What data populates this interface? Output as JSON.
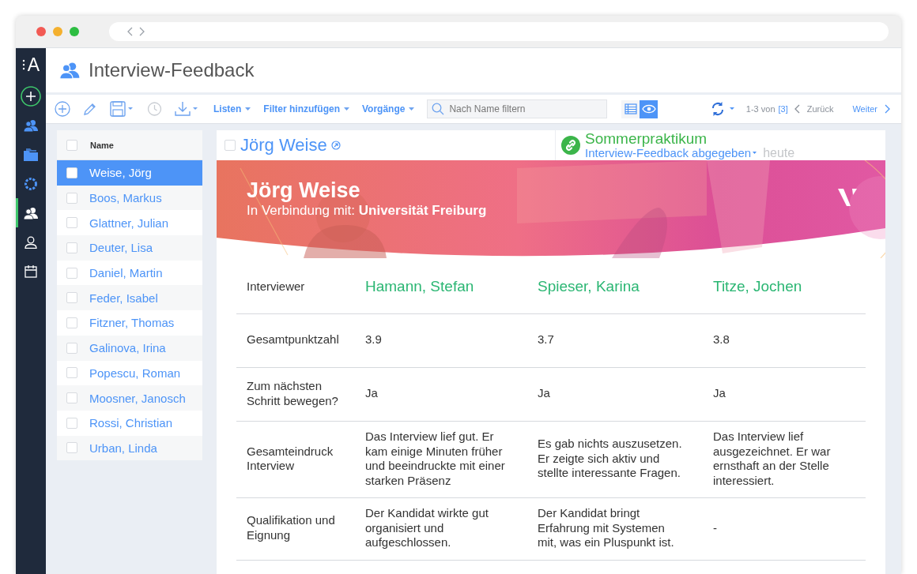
{
  "sidebar": {
    "logo": "A",
    "items": [
      {
        "kind": "add",
        "selected": false
      },
      {
        "kind": "people",
        "selected": false
      },
      {
        "kind": "folder",
        "selected": false
      },
      {
        "kind": "gear",
        "selected": false
      },
      {
        "kind": "people",
        "selected": true
      },
      {
        "kind": "person",
        "selected": false
      },
      {
        "kind": "calendar",
        "selected": false
      }
    ]
  },
  "page": {
    "title": "Interview-Feedback"
  },
  "toolbar": {
    "menus": [
      "Listen",
      "Filter hinzufügen",
      "Vorgänge"
    ],
    "search": {
      "placeholder": "Nach Name filtern"
    },
    "views": [
      {
        "kind": "table",
        "selected": false
      },
      {
        "kind": "card",
        "selected": true
      }
    ],
    "pagination": {
      "range": "1-3 von",
      "total": "[3]",
      "prev": "Zurück",
      "next": "Weiter"
    }
  },
  "list": {
    "header": "Name",
    "header_checked": false,
    "rows": [
      {
        "name": "Weise, Jörg",
        "selected": true
      },
      {
        "name": "Boos, Markus",
        "selected": false
      },
      {
        "name": "Glattner, Julian",
        "selected": false
      },
      {
        "name": "Deuter, Lisa",
        "selected": false
      },
      {
        "name": "Daniel, Martin",
        "selected": false
      },
      {
        "name": "Feder, Isabel",
        "selected": false
      },
      {
        "name": "Fitzner, Thomas",
        "selected": false
      },
      {
        "name": "Galinova, Irina",
        "selected": false
      },
      {
        "name": "Popescu, Roman",
        "selected": false
      },
      {
        "name": "Moosner, Janosch",
        "selected": false
      },
      {
        "name": "Rossi, Christian",
        "selected": false
      },
      {
        "name": "Urban, Linda",
        "selected": false
      }
    ]
  },
  "detail": {
    "name": "Jörg Weise",
    "checked": false,
    "process": {
      "title": "Sommerpraktikum",
      "status": "Interview-Feedback abgegeben",
      "date": "heute"
    },
    "banner": {
      "name": "Jörg Weise",
      "connection_label": "In Verbindung mit:",
      "connection": "Universität Freiburg"
    },
    "rows": [
      {
        "label": "Interviewer",
        "kind": "names",
        "values": [
          "Hamann, Stefan",
          "Spieser, Karina",
          "Titze, Jochen"
        ]
      },
      {
        "label": "Gesamtpunktzahl",
        "kind": "text",
        "values": [
          "3.9",
          "3.7",
          "3.8"
        ]
      },
      {
        "label": "Zum nächsten Schritt bewegen?",
        "kind": "text",
        "values": [
          "Ja",
          "Ja",
          "Ja"
        ]
      },
      {
        "label": "Gesamteindruck Interview",
        "kind": "text",
        "values": [
          "Das Interview lief gut. Er kam einige Minuten früher und beeindruckte mit einer starken Präsenz",
          "Es gab nichts auszusetzen. Er zeigte sich aktiv und stellte interessante Fragen.",
          "Das Interview lief ausgezeichnet. Er war ernsthaft an der Stelle interessiert."
        ]
      },
      {
        "label": "Qualifikation und Eignung",
        "kind": "text",
        "values": [
          "Der Kandidat wirkte gut organisiert und aufgeschlossen.",
          "Der Kandidat bringt Erfahrung mit Systemen mit, was ein Pluspunkt ist.",
          "-"
        ]
      }
    ]
  }
}
